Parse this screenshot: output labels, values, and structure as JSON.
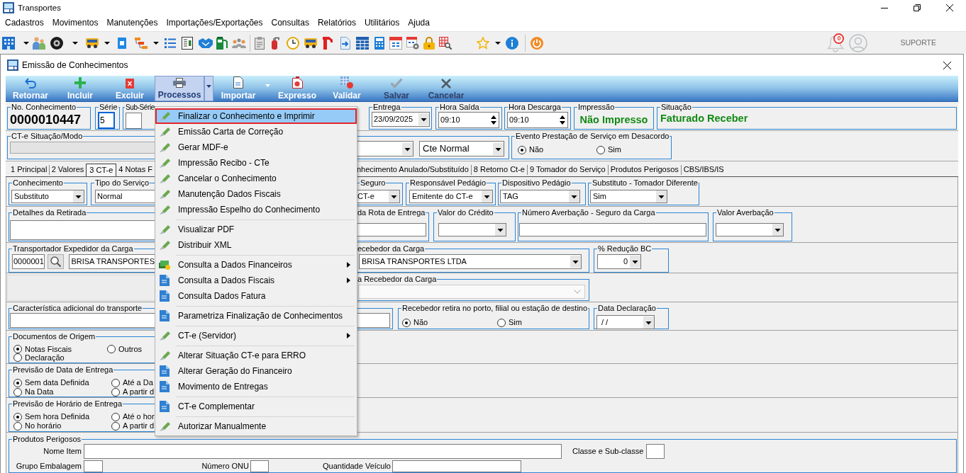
{
  "window": {
    "title": "Transportes"
  },
  "menu_bar": [
    "Cadastros",
    "Movimentos",
    "Manutenções",
    "Importações/Exportações",
    "Consultas",
    "Relatórios",
    "Utilitários",
    "Ajuda"
  ],
  "toolbar": {
    "notification_count": "0",
    "user_name": "SUPORTE"
  },
  "document_window": {
    "title": "Emissão de Conhecimentos"
  },
  "actions": [
    {
      "label": "Retornar",
      "kind": "back",
      "selected": false,
      "disabled": false,
      "split": false
    },
    {
      "label": "Incluir",
      "kind": "add",
      "selected": false,
      "disabled": false,
      "split": false
    },
    {
      "label": "Excluir",
      "kind": "delete",
      "selected": false,
      "disabled": false,
      "split": false
    },
    {
      "label": "Processos",
      "kind": "print",
      "selected": true,
      "disabled": false,
      "split": true
    },
    {
      "label": "Importar",
      "kind": "import",
      "selected": false,
      "disabled": false,
      "split": true
    },
    {
      "label": "Expresso",
      "kind": "express",
      "selected": false,
      "disabled": false,
      "split": false
    },
    {
      "label": "Validar",
      "kind": "validate",
      "selected": false,
      "disabled": false,
      "split": false
    },
    {
      "label": "Salvar",
      "kind": "save",
      "selected": false,
      "disabled": true,
      "split": false
    },
    {
      "label": "Cancelar",
      "kind": "cancel",
      "selected": false,
      "disabled": true,
      "split": false
    }
  ],
  "header": {
    "number": {
      "label": "No. Conhecimento",
      "value": "0000010447"
    },
    "series": {
      "label": "Série",
      "value": "5"
    },
    "sub_series": {
      "label": "Sub-Série"
    },
    "delivery_date": {
      "label": "Entrega",
      "value": "23/09/2025"
    },
    "departure_time": {
      "label": "Hora Saída",
      "value": "09:10"
    },
    "unload_time": {
      "label": "Hora Descarga",
      "value": "09:10"
    },
    "printing": {
      "label": "Impressão",
      "value": "Não Impresso"
    },
    "status": {
      "label": "Situação",
      "value": "Faturado Receber"
    }
  },
  "mode_row": {
    "mode": {
      "label": "CT-e Situação/Modo",
      "value": "Cte Normal"
    },
    "disagreement": {
      "label": "Evento Prestação de Serviço em Desacordo",
      "options": [
        {
          "label": "Não",
          "selected": true
        },
        {
          "label": "Sim",
          "selected": false
        }
      ]
    }
  },
  "tab_groups": [
    {
      "tabs": [
        {
          "label": "1 Principal",
          "selected": false
        },
        {
          "label": "2 Valores",
          "selected": false
        },
        {
          "label": "3 CT-e",
          "selected": true
        },
        {
          "label": "4 Notas F",
          "selected": false
        }
      ]
    },
    {
      "tabs": [
        {
          "label": "nhecimento Anulado/Substituído",
          "selected": false
        },
        {
          "label": "8 Retorno Ct-e",
          "selected": false
        },
        {
          "label": "9 Tomador do Serviço",
          "selected": false
        },
        {
          "label": "Produtos Perigosos",
          "selected": false
        },
        {
          "label": "CBS/IBS/IS",
          "selected": false
        }
      ]
    }
  ],
  "cte_tab": {
    "document_type": {
      "label": "Conhecimento",
      "value": "Substituto"
    },
    "service_type": {
      "label": "Tipo do Serviço",
      "value": "Normal"
    },
    "insurance": {
      "label": "Seguro",
      "value": "CT-e"
    },
    "toll_responsible": {
      "label": "Responsável Pedágio",
      "value": "Emitente do CT-e"
    },
    "toll_device": {
      "label": "Dispositivo Pedágio",
      "value": "TAG"
    },
    "different_payer": {
      "label": "Substituto - Tomador Diferente",
      "value": "Sim"
    },
    "pickup_details": {
      "label": "Detalhes da Retirada"
    },
    "delivery_route": {
      "label": "da Rota de Entrega"
    },
    "credit_value": {
      "label": "Valor do Crédito"
    },
    "insurance_number": {
      "label": "Número Averbação - Seguro da Carga"
    },
    "insurance_value": {
      "label": "Valor Averbação"
    },
    "shipper": {
      "label": "Transportador Expedidor da Carga",
      "code": "0000001",
      "name": "BRISA TRANSPORTES"
    },
    "receiver": {
      "label": "ecebedor da Carga",
      "value": "BRISA TRANSPORTES LTDA"
    },
    "bc_reduction": {
      "label": "% Redução BC",
      "value": "0"
    },
    "receiver_2": {
      "label": "a Recebedor da Carga"
    },
    "extra_feature": {
      "label": "Característica adicional do transporte"
    },
    "receiver_pickup": {
      "label": "Recebedor retira no porto, filial ou estação de destino",
      "options": [
        {
          "label": "Não",
          "selected": true
        },
        {
          "label": "Sim",
          "selected": false
        }
      ]
    },
    "declaration_date": {
      "label": "Data Declaração",
      "value": "/ /"
    },
    "origin_documents": {
      "label": "Documentos de Origem",
      "options": [
        {
          "label": "Notas Fiscais",
          "selected": true
        },
        {
          "label": "Outros",
          "selected": false
        },
        {
          "label": "Declaração",
          "selected": false
        }
      ]
    },
    "delivery_date_forecast": {
      "label": "Previsão de Data de Entrega",
      "options": [
        {
          "label": "Sem data Definida",
          "selected": true
        },
        {
          "label": "Até a Da",
          "selected": false
        },
        {
          "label": "Na Data",
          "selected": false
        },
        {
          "label": "A partir d",
          "selected": false
        }
      ]
    },
    "delivery_time_forecast": {
      "label": "Previsão de Horário de Entrega",
      "options": [
        {
          "label": "Sem hora Definida",
          "selected": true
        },
        {
          "label": "Até o hor",
          "selected": false
        },
        {
          "label": "No horário",
          "selected": false
        },
        {
          "label": "A partir d",
          "selected": false
        }
      ]
    },
    "dangerous_goods": {
      "label": "Produtos Perigosos",
      "fields": [
        {
          "label": "Nome Item"
        },
        {
          "label": "Classe e Sub-classe"
        },
        {
          "label": "Grupo Embalagem"
        },
        {
          "label": "Número ONU"
        },
        {
          "label": "Quantidade Veículo"
        }
      ]
    }
  },
  "process_menu": {
    "groups": [
      {
        "items": [
          {
            "label": "Finalizar o Conhecimento e Imprimir",
            "kind": "tool",
            "submenu": false,
            "selected": true
          },
          {
            "label": "Emissão Carta de Correção",
            "kind": "tool",
            "submenu": false,
            "selected": false
          },
          {
            "label": "Gerar MDF-e",
            "kind": "tool",
            "submenu": false,
            "selected": false
          },
          {
            "label": "Impressão Recibo - CTe",
            "kind": "tool",
            "submenu": false,
            "selected": false
          },
          {
            "label": "Cancelar o Conhecimento",
            "kind": "tool",
            "submenu": false,
            "selected": false
          },
          {
            "label": "Manutenção Dados Fiscais",
            "kind": "tool",
            "submenu": false,
            "selected": false
          },
          {
            "label": "Impressão Espelho do Conhecimento",
            "kind": "tool",
            "submenu": false,
            "selected": false
          }
        ]
      },
      {
        "items": [
          {
            "label": "Visualizar PDF",
            "kind": "tool",
            "submenu": false,
            "selected": false
          },
          {
            "label": "Distribuir XML",
            "kind": "tool",
            "submenu": false,
            "selected": false
          }
        ]
      },
      {
        "items": [
          {
            "label": "Consulta a Dados Financeiros",
            "kind": "money",
            "submenu": true,
            "selected": false
          },
          {
            "label": "Consulta a Dados Fiscais",
            "kind": "document",
            "submenu": true,
            "selected": false
          },
          {
            "label": "Consulta Dados Fatura",
            "kind": "document",
            "submenu": false,
            "selected": false
          }
        ]
      },
      {
        "items": [
          {
            "label": "Parametriza Finalização de Conhecimentos",
            "kind": "document",
            "submenu": false,
            "selected": false
          }
        ]
      },
      {
        "items": [
          {
            "label": "CT-e (Servidor)",
            "kind": "tool",
            "submenu": true,
            "selected": false
          }
        ]
      },
      {
        "items": [
          {
            "label": "Alterar Situação CT-e para ERRO",
            "kind": "tool",
            "submenu": false,
            "selected": false
          },
          {
            "label": "Alterar Geração do Financeiro",
            "kind": "document",
            "submenu": false,
            "selected": false
          },
          {
            "label": "Movimento de Entregas",
            "kind": "document",
            "submenu": false,
            "selected": false
          }
        ]
      },
      {
        "items": [
          {
            "label": "CT-e Complementar",
            "kind": "document",
            "submenu": false,
            "selected": false
          }
        ]
      },
      {
        "items": [
          {
            "label": "Autorizar Manualmente",
            "kind": "tool",
            "submenu": false,
            "selected": false
          }
        ]
      }
    ]
  }
}
